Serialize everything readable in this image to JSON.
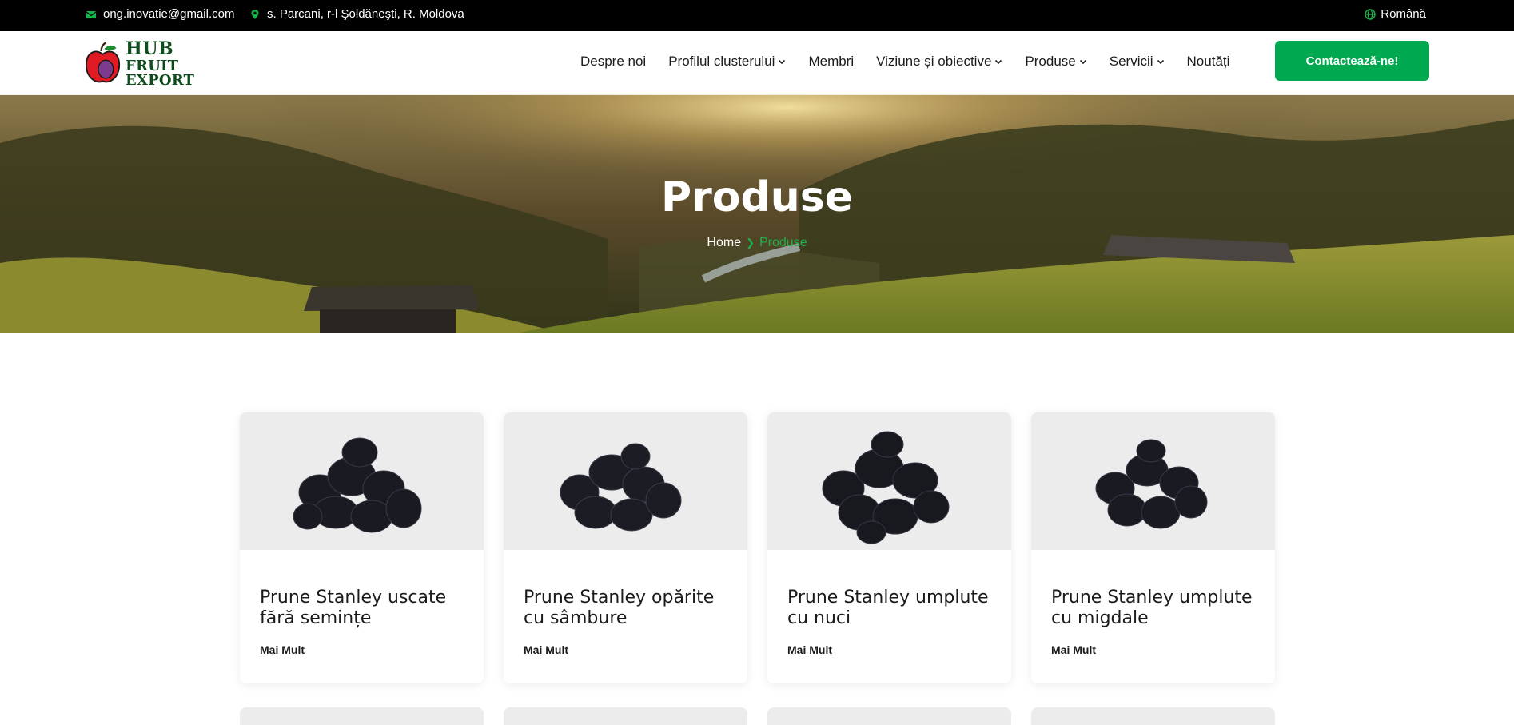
{
  "topbar": {
    "email": "ong.inovatie@gmail.com",
    "address": "s. Parcani, r-l Şoldăneşti, R. Moldova",
    "language": "Română"
  },
  "brand": {
    "line1": "HUB",
    "line2": "FRUIT EXPORT"
  },
  "nav": {
    "items": [
      {
        "label": "Despre noi",
        "dropdown": false
      },
      {
        "label": "Profilul clusterului",
        "dropdown": true
      },
      {
        "label": "Membri",
        "dropdown": false
      },
      {
        "label": "Viziune și obiective",
        "dropdown": true
      },
      {
        "label": "Produse",
        "dropdown": true
      },
      {
        "label": "Servicii",
        "dropdown": true
      },
      {
        "label": "Noutăți",
        "dropdown": false
      }
    ],
    "cta": "Contactează-ne!"
  },
  "hero": {
    "title": "Produse",
    "breadcrumb": {
      "home": "Home",
      "current": "Produse"
    }
  },
  "products": [
    {
      "title": "Prune Stanley uscate fără semințe",
      "more": "Mai Mult"
    },
    {
      "title": "Prune Stanley opărite cu sâmbure",
      "more": "Mai Mult"
    },
    {
      "title": "Prune Stanley umplute cu nuci",
      "more": "Mai Mult"
    },
    {
      "title": "Prune Stanley umplute cu migdale",
      "more": "Mai Mult"
    }
  ],
  "colors": {
    "accent": "#00a94f",
    "topbar": "#000000"
  }
}
